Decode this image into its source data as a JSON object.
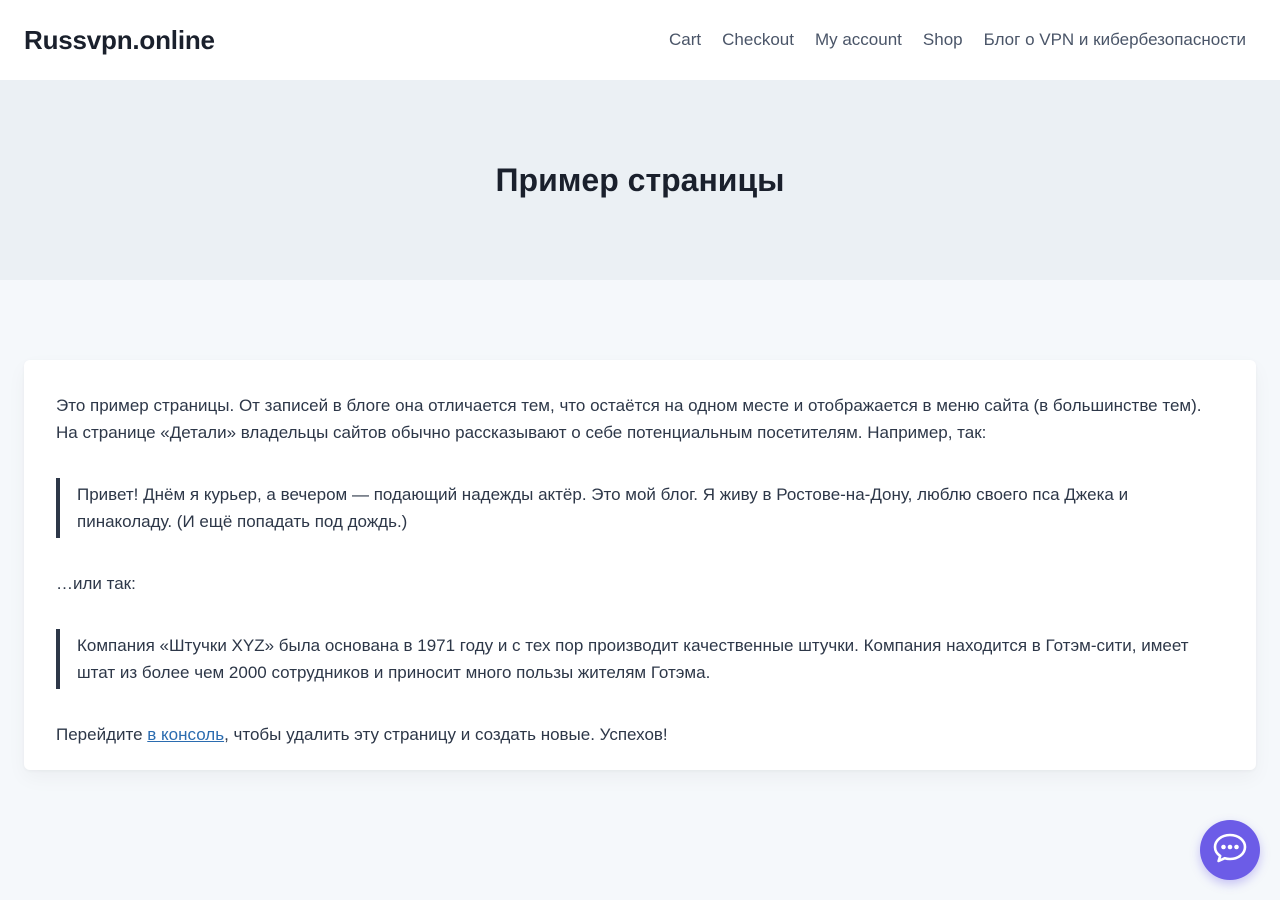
{
  "header": {
    "site_title": "Russvpn.online",
    "nav": [
      {
        "label": "Cart"
      },
      {
        "label": "Checkout"
      },
      {
        "label": "My account"
      },
      {
        "label": "Shop"
      },
      {
        "label": "Блог о VPN и кибербезопасности"
      }
    ]
  },
  "hero": {
    "title": "Пример страницы"
  },
  "content": {
    "intro": "Это пример страницы. От записей в блоге она отличается тем, что остаётся на одном месте и отображается в меню сайта (в большинстве тем). На странице «Детали» владельцы сайтов обычно рассказывают о себе потенциальным посетителям. Например, так:",
    "quote1": "Привет! Днём я курьер, а вечером — подающий надежды актёр. Это мой блог. Я живу в Ростове-на-Дону, люблю своего пса Джека и пинаколаду. (И ещё попадать под дождь.)",
    "or_text": "…или так:",
    "quote2": "Компания «Штучки XYZ» была основана в 1971 году и с тех пор производит качественные штучки. Компания находится в Готэм-сити, имеет штат из более чем 2000 сотрудников и приносит много пользы жителям Готэма.",
    "outro_before": "Перейдите ",
    "outro_link": "в консоль",
    "outro_after": ", чтобы удалить эту страницу и создать новые. Успехов!"
  },
  "chat_widget": {
    "icon": "chat-bubble-icon",
    "color": "#6c5ce7"
  }
}
